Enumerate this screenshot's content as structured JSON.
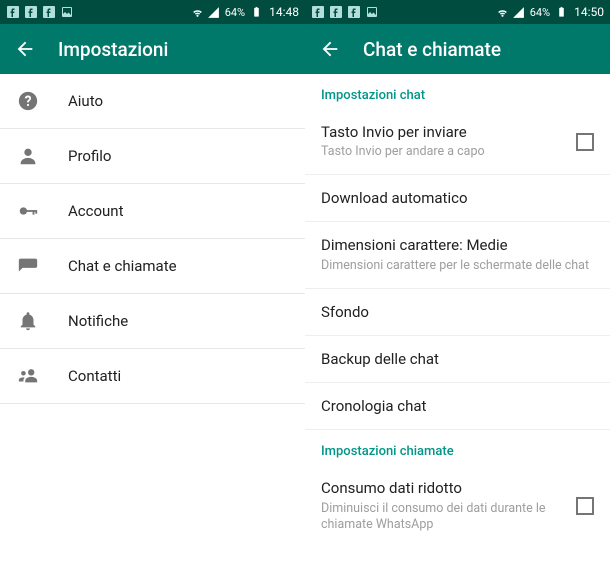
{
  "left": {
    "status": {
      "battery": "64%",
      "time": "14:48"
    },
    "appbar": {
      "title": "Impostazioni"
    },
    "items": [
      {
        "name": "help",
        "label": "Aiuto"
      },
      {
        "name": "profile",
        "label": "Profilo"
      },
      {
        "name": "account",
        "label": "Account"
      },
      {
        "name": "chat",
        "label": "Chat e chiamate"
      },
      {
        "name": "notif",
        "label": "Notifiche"
      },
      {
        "name": "contacts",
        "label": "Contatti"
      }
    ]
  },
  "right": {
    "status": {
      "battery": "64%",
      "time": "14:50"
    },
    "appbar": {
      "title": "Chat e chiamate"
    },
    "section_chat": "Impostazioni chat",
    "enter_send": {
      "title": "Tasto Invio per inviare",
      "subtitle": "Tasto Invio per andare a capo",
      "checked": false
    },
    "auto_download": {
      "title": "Download automatico"
    },
    "font_size": {
      "title": "Dimensioni carattere: Medie",
      "subtitle": "Dimensioni carattere per le schermate delle chat"
    },
    "wallpaper": {
      "title": "Sfondo"
    },
    "backup": {
      "title": "Backup delle chat"
    },
    "history": {
      "title": "Cronologia chat"
    },
    "section_calls": "Impostazioni chiamate",
    "low_data": {
      "title": "Consumo dati ridotto",
      "subtitle": "Diminuisci il consumo dei dati durante le chiamate WhatsApp",
      "checked": false
    }
  }
}
